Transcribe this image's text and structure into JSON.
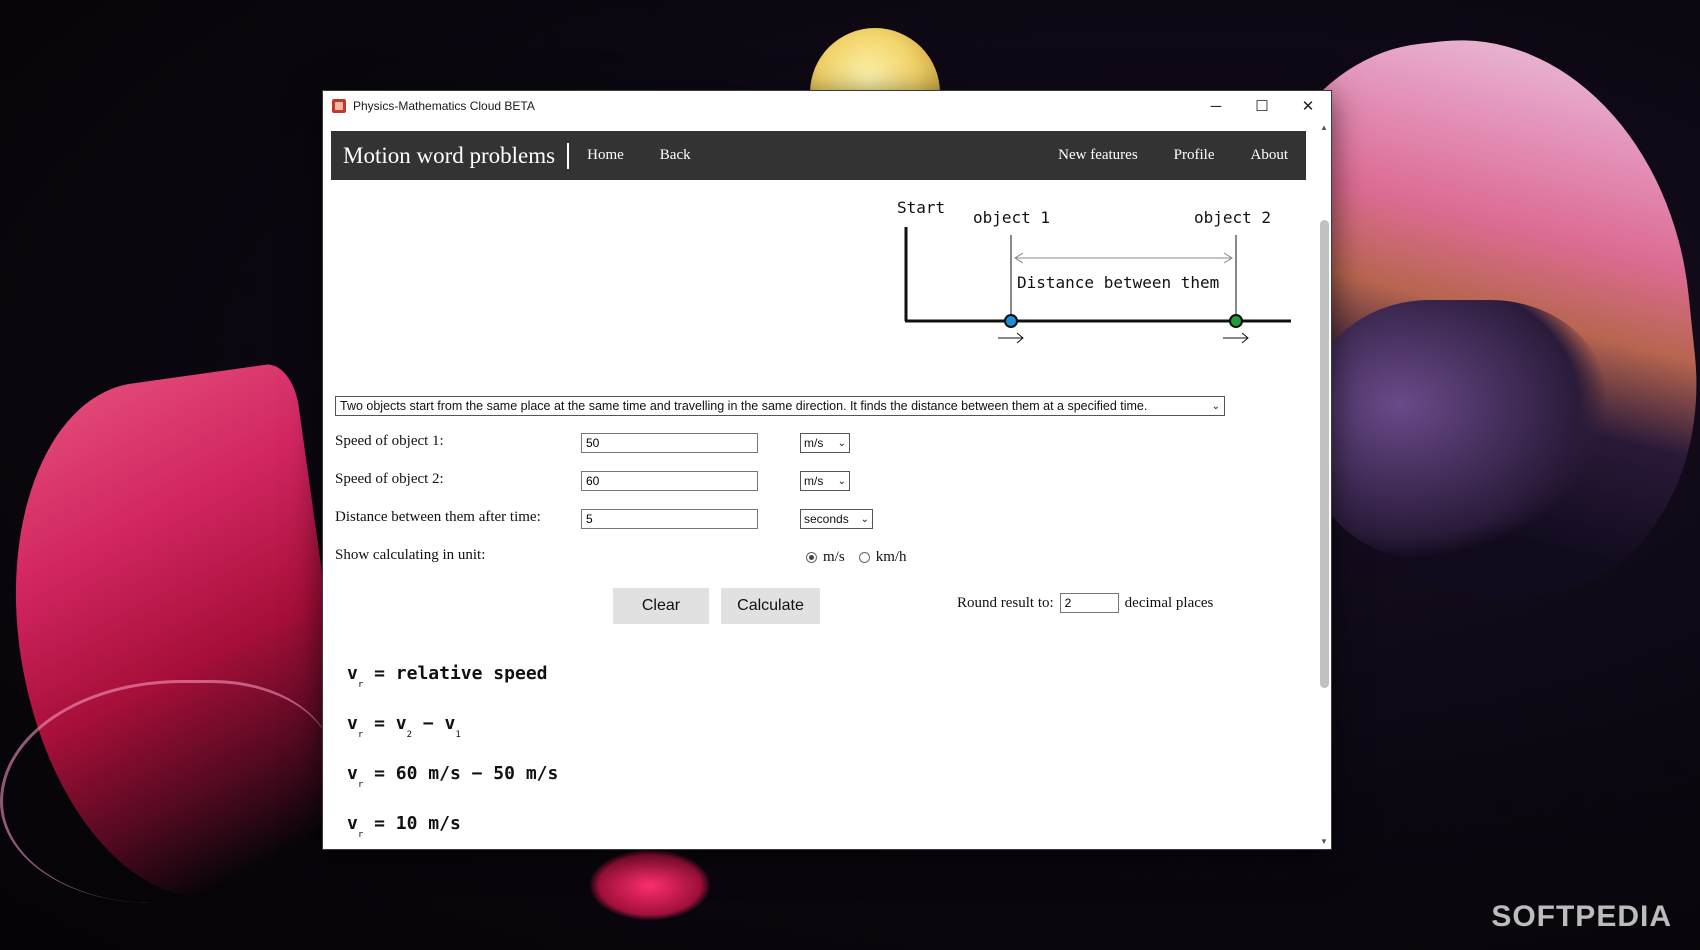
{
  "window": {
    "title": "Physics-Mathematics Cloud BETA",
    "controls": {
      "minimize": "─",
      "maximize": "☐",
      "close": "✕"
    }
  },
  "navbar": {
    "brand": "Motion word problems",
    "links_left": [
      "Home",
      "Back"
    ],
    "links_right": [
      "New features",
      "Profile",
      "About"
    ]
  },
  "diagram": {
    "start_label": "Start",
    "object1_label": "object 1",
    "object2_label": "object 2",
    "distance_label": "Distance between them",
    "object1_color": "#1e90d6",
    "object2_color": "#1f9d3a"
  },
  "problem": {
    "selected": "Two objects start from the same place at the same time and travelling in the same direction. It finds the distance between them at a specified time."
  },
  "form": {
    "speed1": {
      "label": "Speed of object 1:",
      "value": "50",
      "unit": "m/s"
    },
    "speed2": {
      "label": "Speed of object 2:",
      "value": "60",
      "unit": "m/s"
    },
    "time": {
      "label": "Distance between them after time:",
      "value": "5",
      "unit": "seconds"
    },
    "calc_unit": {
      "label": "Show calculating in unit:",
      "options": [
        "m/s",
        "km/h"
      ],
      "selected": "m/s"
    },
    "clear_label": "Clear",
    "calculate_label": "Calculate",
    "round": {
      "label": "Round result to:",
      "value": "2",
      "suffix": "decimal places"
    }
  },
  "results": {
    "line1": {
      "v": "v",
      "sub": "r",
      "rest": " = relative speed"
    },
    "line2": {
      "v": "v",
      "sub": "r",
      "eq": " = v",
      "sub2": "2",
      "minus": " − v",
      "sub3": "1"
    },
    "line3": {
      "v": "v",
      "sub": "r",
      "rest": " = 60 m/s − 50 m/s"
    },
    "line4": {
      "v": "v",
      "sub": "r",
      "rest": " = 10 m/s"
    }
  },
  "watermark": "SOFTPEDIA"
}
